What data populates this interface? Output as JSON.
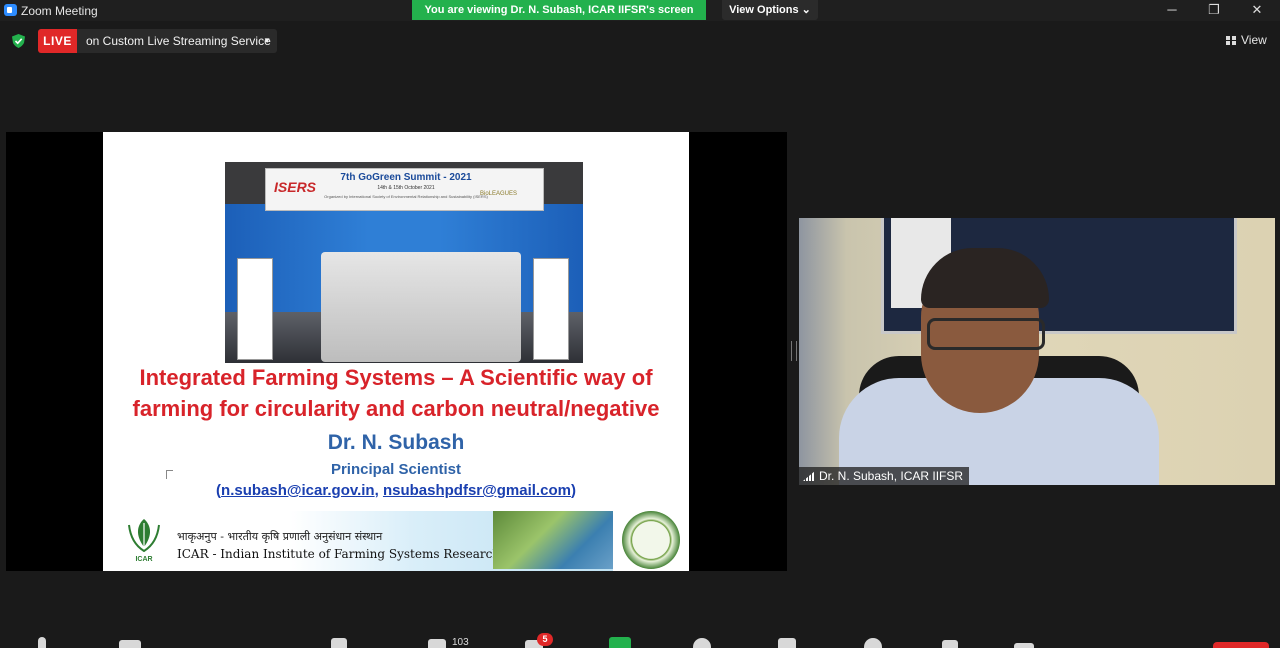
{
  "window": {
    "title": "Zoom Meeting",
    "viewing_banner": "You are viewing Dr. N. Subash, ICAR IIFSR's screen",
    "view_options": "View Options",
    "controls": {
      "minimize": "─",
      "restore": "❐",
      "close": "✕"
    }
  },
  "live": {
    "badge": "LIVE",
    "service": "on Custom Live Streaming Service",
    "view_label": "View"
  },
  "slide": {
    "summit_title": "7th GoGreen Summit - 2021",
    "summit_date": "14th & 15th October 2021",
    "summit_org": "Organized by International Society of Environmental Relationship and Sustainability (ISERS)",
    "iseris_logo": "ISERS",
    "bioleagues_logo": "BioLEAGUES",
    "headline_line1": "Integrated Farming Systems – A Scientific way of",
    "headline_line2": "farming for circularity and carbon neutral/negative",
    "presenter_name": "Dr. N. Subash",
    "presenter_role": "Principal Scientist",
    "email_open": "(",
    "email1": "n.subash@icar.gov.in",
    "email_sep": ", ",
    "email2": "nsubashpdfsr@gmail.com",
    "email_close": ")",
    "footer_hindi": "भाकृअनुप - भारतीय कृषि प्रणाली अनुसंधान संस्थान",
    "footer_english": "ICAR - Indian Institute of Farming Systems Research",
    "icar_logo_text": "ICAR"
  },
  "participant": {
    "name": "Dr. N. Subash, ICAR IIFSR"
  },
  "toolbar": {
    "participants_count": "103",
    "chat_badge": "5"
  },
  "colors": {
    "live_red": "#e02828",
    "banner_green": "#23b14d",
    "headline_red": "#d8232a",
    "name_blue": "#2f63a8"
  }
}
